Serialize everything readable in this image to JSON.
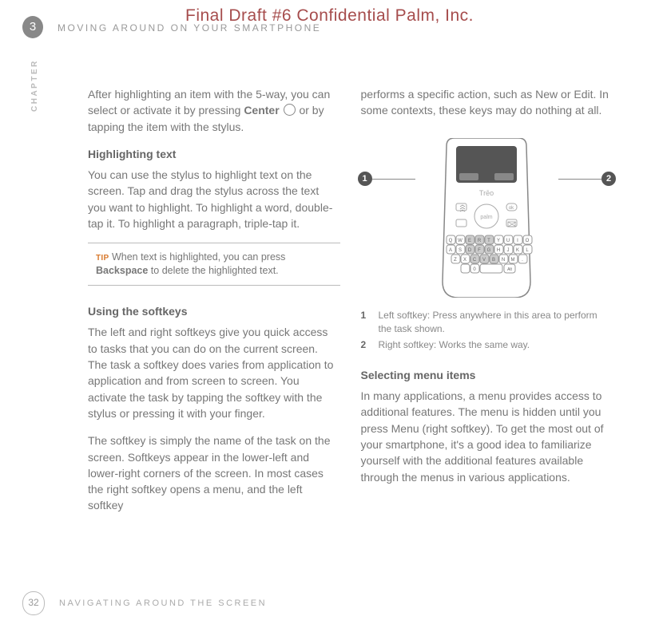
{
  "watermark": "Final Draft #6     Confidential     Palm, Inc.",
  "chapter_number": "3",
  "header_title": "MOVING AROUND ON YOUR SMARTPHONE",
  "chapter_label": "CHAPTER",
  "left_col": {
    "p1_a": "After highlighting an item with the 5-way, you can select or activate it by pressing ",
    "p1_bold": "Center",
    "p1_b": " or by tapping the item with the stylus.",
    "h1": "Highlighting text",
    "p2": "You can use the stylus to highlight text on the screen. Tap and drag the stylus across the text you want to highlight. To highlight a word, double-tap it. To highlight a paragraph, triple-tap it.",
    "tip_label": "TIP",
    "tip_a": " When text is highlighted, you can press ",
    "tip_bold": "Backspace",
    "tip_b": " to delete the highlighted text.",
    "h2": "Using the softkeys",
    "p3": "The left and right softkeys give you quick access to tasks that you can do on the current screen. The task a softkey does varies from application to application and from screen to screen. You activate the task by tapping the softkey with the stylus or pressing it with your finger.",
    "p4": "The softkey is simply the name of the task on the screen. Softkeys appear in the lower-left and lower-right corners of the screen. In most cases the right softkey opens a menu, and the left softkey"
  },
  "right_col": {
    "p1": "performs a specific action, such as New or Edit. In some contexts, these keys may do nothing at all.",
    "callout_1": "1",
    "callout_2": "2",
    "fig_items": [
      {
        "num": "1",
        "text": "Left softkey: Press anywhere in this area to perform the task shown."
      },
      {
        "num": "2",
        "text": "Right softkey: Works the same way."
      }
    ],
    "h1": "Selecting menu items",
    "p2": "In many applications, a menu provides access to additional features. The menu is hidden until you press Menu (right softkey). To get the most out of your smartphone, it's a good idea to familiarize yourself with the additional features available through the menus in various applications."
  },
  "footer": {
    "page": "32",
    "title": "NAVIGATING AROUND THE SCREEN"
  }
}
